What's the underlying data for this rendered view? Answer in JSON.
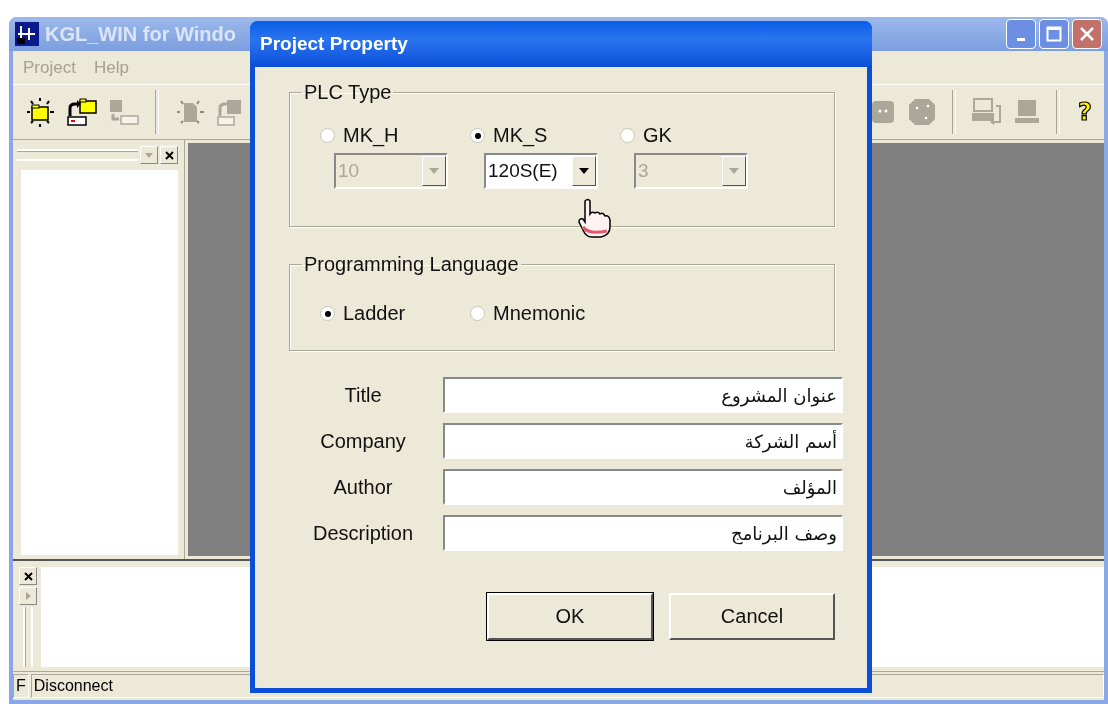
{
  "main_window": {
    "title": "KGL_WIN for Windo",
    "active": false
  },
  "menu": [
    {
      "label": "Project"
    },
    {
      "label": "Help"
    }
  ],
  "toolbar": [
    {
      "kind": "new",
      "disabled": false
    },
    {
      "kind": "open",
      "disabled": false
    },
    {
      "kind": "transfer",
      "disabled": true
    },
    {
      "kind": "separator"
    },
    {
      "kind": "new-page",
      "disabled": true
    },
    {
      "kind": "page-arrow",
      "disabled": true
    },
    {
      "kind": "gap"
    },
    {
      "kind": "chip",
      "disabled": true
    },
    {
      "kind": "round-chip",
      "disabled": true
    },
    {
      "kind": "separator"
    },
    {
      "kind": "monitor-transfer",
      "disabled": true
    },
    {
      "kind": "monitor",
      "disabled": true
    },
    {
      "kind": "separator"
    },
    {
      "kind": "help",
      "label": "?",
      "disabled": false
    }
  ],
  "status_bar": [
    "F",
    "Disconnect"
  ],
  "dialog": {
    "title": "Project Property",
    "plc_type": {
      "label": "PLC Type",
      "options": [
        {
          "label": "MK_H",
          "selected": false,
          "combo": {
            "value": "10",
            "disabled": true
          }
        },
        {
          "label": "MK_S",
          "selected": true,
          "combo": {
            "value": "120S(E)",
            "disabled": false
          }
        },
        {
          "label": "GK",
          "selected": false,
          "combo": {
            "value": "3",
            "disabled": true
          }
        }
      ]
    },
    "programming_language": {
      "label": "Programming Language",
      "options": [
        {
          "label": "Ladder",
          "selected": true
        },
        {
          "label": "Mnemonic",
          "selected": false
        }
      ]
    },
    "fields": [
      {
        "label": "Title",
        "value": "عنوان المشروع"
      },
      {
        "label": "Company",
        "value": "أسم الشركة"
      },
      {
        "label": "Author",
        "value": "المؤلف"
      },
      {
        "label": "Description",
        "value": "وصف البرنامج"
      }
    ],
    "buttons": [
      {
        "label": "OK",
        "default": true
      },
      {
        "label": "Cancel",
        "default": false
      }
    ]
  }
}
